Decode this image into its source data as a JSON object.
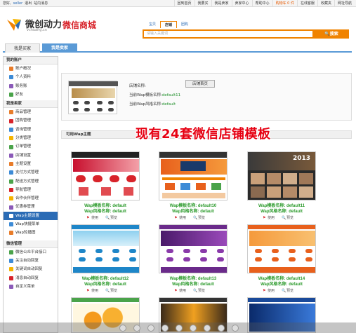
{
  "topbar": {
    "greeting": "您好,",
    "username": "seller",
    "logout": "退出",
    "messages": "站内消息",
    "links": [
      "回到首页",
      "我要买",
      "我是卖家",
      "卖家中心",
      "帮助中心",
      "购物车 0 件",
      "在线客服",
      "收藏夹",
      "网址导航"
    ]
  },
  "header": {
    "brand": "微创动力",
    "brand_en": "vchuang.cn",
    "brand_sub": "微信商城",
    "search_tabs": [
      "宝贝",
      "店铺",
      "团购"
    ],
    "search_placeholder": "请输入关键词",
    "search_button": "搜索"
  },
  "nav": {
    "tabs": [
      "我是买家",
      "我是卖家"
    ]
  },
  "sidebar": {
    "sections": [
      {
        "title": "我的账户",
        "items": [
          "账户概况",
          "个人资料",
          "账务账",
          "好友"
        ]
      },
      {
        "title": "我是卖家",
        "items": [
          "商品管理",
          "团购管理",
          "咨询管理",
          "分类管理",
          "订单管理",
          "店铺设置",
          "主题设置",
          "支付方式管理",
          "配送方式管理",
          "导航管理",
          "合作伙伴管理",
          "优惠券管理",
          "Wap主题设置",
          "Wap快捷菜单",
          "Wap轮播图"
        ]
      },
      {
        "title": "微信管理",
        "items": [
          "微信公众平台接口",
          "关注自动回复",
          "关键词自动回复",
          "消息自动回复",
          "自定义菜单"
        ]
      }
    ],
    "selected": "Wap主题设置"
  },
  "shop": {
    "name_label": "店铺名称:",
    "template_label": "当前Wap模板名称:",
    "template_value": "default11",
    "style_label": "当前Wap风格名称:",
    "style_value": "default",
    "home_button": "店铺首页"
  },
  "themes": {
    "header": "可用Wap主题",
    "overlay": "现有24套微信店铺模板",
    "use_label": "使用",
    "preview_label": "预览",
    "template_prefix": "Wap模板名称:",
    "style_prefix": "Wap风格名称:",
    "items": [
      {
        "template": "Wap模板名称: default",
        "style": "Wap风格名称: default"
      },
      {
        "template": "Wap模板名称: default10",
        "style": "Wap风格名称: default"
      },
      {
        "template": "Wap模板名称: default11",
        "style": "Wap风格名称: default"
      },
      {
        "template": "Wap模板名称: default12",
        "style": "Wap风格名称: default"
      },
      {
        "template": "Wap模板名称: default13",
        "style": "Wap风格名称: default"
      },
      {
        "template": "Wap模板名称: default14",
        "style": "Wap风格名称: default"
      }
    ]
  },
  "colors": {
    "accent": "#f08300",
    "brand_red": "#d8232a",
    "nav_blue": "#5a9ad6",
    "template_green": "#2b9a2b"
  }
}
